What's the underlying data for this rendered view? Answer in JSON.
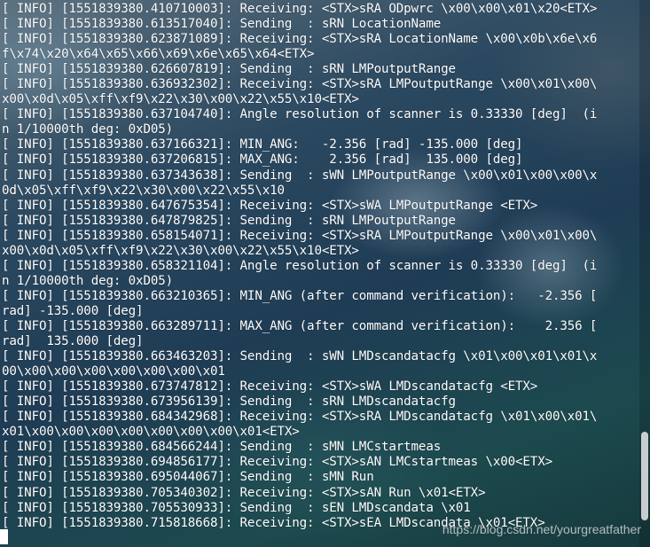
{
  "terminal": {
    "lines": [
      "[ INFO] [1551839380.410710003]: Receiving: <STX>sRA ODpwrc \\x00\\x00\\x01\\x20<ETX>",
      "[ INFO] [1551839380.613517040]: Sending  : sRN LocationName",
      "[ INFO] [1551839380.623871089]: Receiving: <STX>sRA LocationName \\x00\\x0b\\x6e\\x6",
      "f\\x74\\x20\\x64\\x65\\x66\\x69\\x6e\\x65\\x64<ETX>",
      "[ INFO] [1551839380.626607819]: Sending  : sRN LMPoutputRange",
      "[ INFO] [1551839380.636932302]: Receiving: <STX>sRA LMPoutputRange \\x00\\x01\\x00\\",
      "x00\\x0d\\x05\\xff\\xf9\\x22\\x30\\x00\\x22\\x55\\x10<ETX>",
      "[ INFO] [1551839380.637104740]: Angle resolution of scanner is 0.33330 [deg]  (i",
      "n 1/10000th deg: 0xD05)",
      "[ INFO] [1551839380.637166321]: MIN_ANG:   -2.356 [rad] -135.000 [deg]",
      "[ INFO] [1551839380.637206815]: MAX_ANG:    2.356 [rad]  135.000 [deg]",
      "[ INFO] [1551839380.637343638]: Sending  : sWN LMPoutputRange \\x00\\x01\\x00\\x00\\x",
      "0d\\x05\\xff\\xf9\\x22\\x30\\x00\\x22\\x55\\x10",
      "[ INFO] [1551839380.647675354]: Receiving: <STX>sWA LMPoutputRange <ETX>",
      "[ INFO] [1551839380.647879825]: Sending  : sRN LMPoutputRange",
      "[ INFO] [1551839380.658154071]: Receiving: <STX>sRA LMPoutputRange \\x00\\x01\\x00\\",
      "x00\\x0d\\x05\\xff\\xf9\\x22\\x30\\x00\\x22\\x55\\x10<ETX>",
      "[ INFO] [1551839380.658321104]: Angle resolution of scanner is 0.33330 [deg]  (i",
      "n 1/10000th deg: 0xD05)",
      "[ INFO] [1551839380.663210365]: MIN_ANG (after command verification):   -2.356 [",
      "rad] -135.000 [deg]",
      "[ INFO] [1551839380.663289711]: MAX_ANG (after command verification):    2.356 [",
      "rad]  135.000 [deg]",
      "[ INFO] [1551839380.663463203]: Sending  : sWN LMDscandatacfg \\x01\\x00\\x01\\x01\\x",
      "00\\x00\\x00\\x00\\x00\\x00\\x00\\x01",
      "[ INFO] [1551839380.673747812]: Receiving: <STX>sWA LMDscandatacfg <ETX>",
      "[ INFO] [1551839380.673956139]: Sending  : sRN LMDscandatacfg",
      "[ INFO] [1551839380.684342968]: Receiving: <STX>sRA LMDscandatacfg \\x01\\x00\\x01\\",
      "x01\\x00\\x00\\x00\\x00\\x00\\x00\\x00\\x01<ETX>",
      "[ INFO] [1551839380.684566244]: Sending  : sMN LMCstartmeas",
      "[ INFO] [1551839380.694856177]: Receiving: <STX>sAN LMCstartmeas \\x00<ETX>",
      "[ INFO] [1551839380.695044067]: Sending  : sMN Run",
      "[ INFO] [1551839380.705340302]: Receiving: <STX>sAN Run \\x01<ETX>",
      "[ INFO] [1551839380.705530933]: Sending  : sEN LMDscandata \\x01",
      "[ INFO] [1551839380.715818668]: Receiving: <STX>sEA LMDscandata \\x01<ETX>"
    ]
  },
  "watermark": {
    "text": "https://blog.csdn.net/yourgreatfather"
  },
  "colors": {
    "text": "#ffffff",
    "scrollbar_thumb": "#c9cdd0"
  }
}
